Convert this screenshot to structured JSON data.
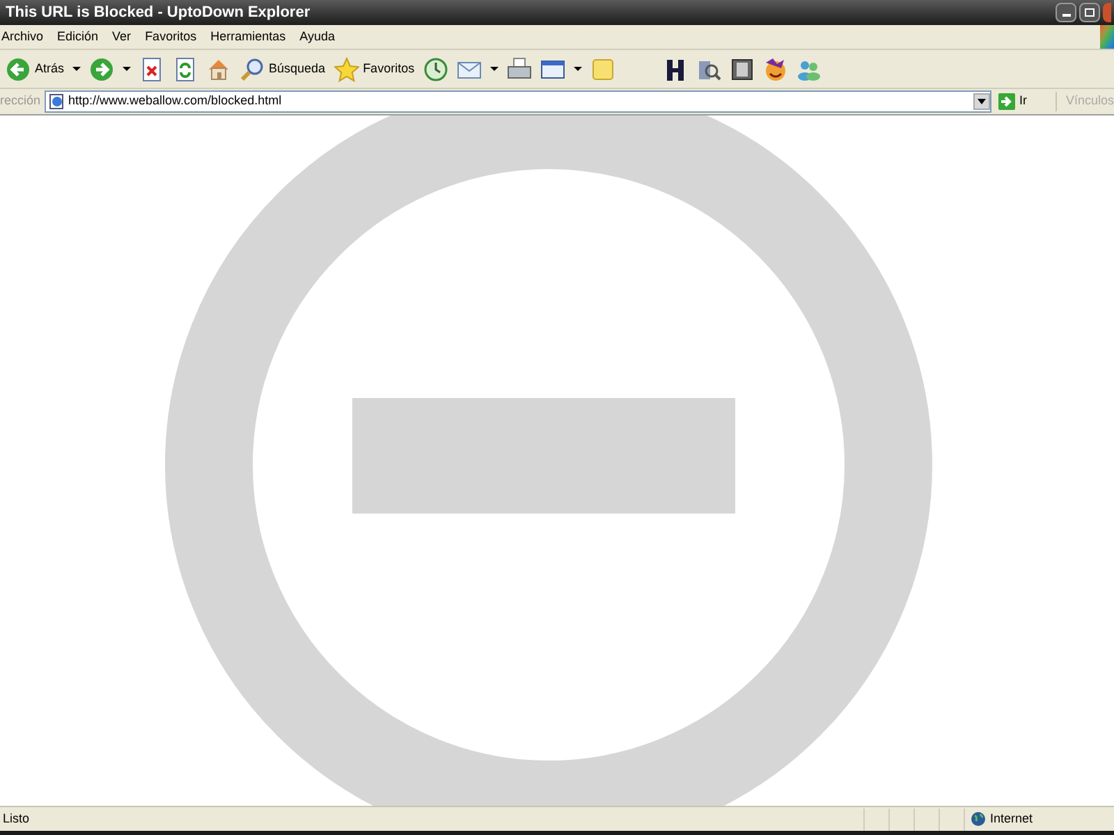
{
  "window": {
    "title": "This URL is Blocked - UptoDown Explorer"
  },
  "menu": [
    "Archivo",
    "Edición",
    "Ver",
    "Favoritos",
    "Herramientas",
    "Ayuda"
  ],
  "toolbar": [
    {
      "kind": "back",
      "label": "Atrás",
      "dropdown": true
    },
    {
      "kind": "forward",
      "dropdown": true
    },
    {
      "kind": "stop"
    },
    {
      "kind": "refresh"
    },
    {
      "kind": "home"
    },
    {
      "kind": "search",
      "label": "Búsqueda"
    },
    {
      "kind": "favorites",
      "label": "Favoritos"
    },
    {
      "kind": "history"
    },
    {
      "kind": "mail",
      "dropdown": true
    },
    {
      "kind": "print"
    },
    {
      "kind": "edit",
      "dropdown": true
    },
    {
      "kind": "note"
    },
    {
      "kind": "letter"
    },
    {
      "kind": "media"
    },
    {
      "kind": "film"
    },
    {
      "kind": "messenger"
    },
    {
      "kind": "people"
    }
  ],
  "address_bar": {
    "label": "rección",
    "url": "http://www.weballow.com/blocked.html",
    "go": "Ir",
    "links": "Vínculos"
  },
  "status_bar": {
    "text": "Listo",
    "zone": "Internet"
  }
}
